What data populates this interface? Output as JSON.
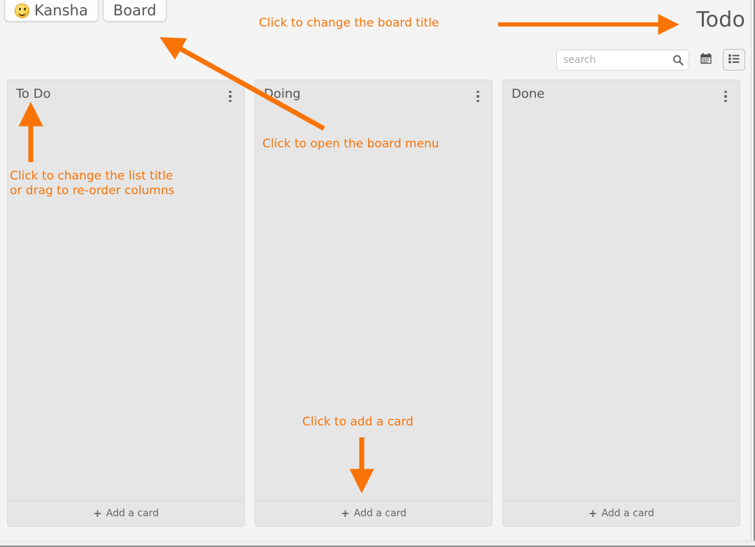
{
  "tabs": [
    {
      "label": "Kansha",
      "icon": "smiley-icon"
    },
    {
      "label": "Board",
      "icon": null
    }
  ],
  "board": {
    "title": "Todo"
  },
  "toolbar": {
    "search_placeholder": "search",
    "search_value": "",
    "search_icon": "search-icon",
    "calendar_icon": "calendar-icon",
    "list_icon": "list-view-icon"
  },
  "columns": [
    {
      "title": "To Do",
      "menu_icon": "kebab-menu-icon",
      "add_card_label": "Add a card",
      "cards": []
    },
    {
      "title": "Doing",
      "menu_icon": "kebab-menu-icon",
      "add_card_label": "Add a card",
      "cards": []
    },
    {
      "title": "Done",
      "menu_icon": "kebab-menu-icon",
      "add_card_label": "Add a card",
      "cards": []
    }
  ],
  "annotations": {
    "board_title": "Click to change the board title",
    "board_menu": "Click to open the board menu",
    "list_title": "Click to change the list title\nor drag to re-order columns",
    "add_card": "Click to add a card",
    "color": "#f97306"
  }
}
